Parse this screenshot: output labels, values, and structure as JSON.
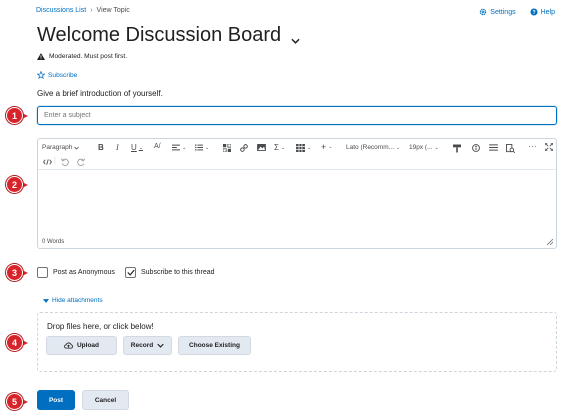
{
  "breadcrumb": {
    "link": "Discussions List",
    "current": "View Topic"
  },
  "header": {
    "settings": "Settings",
    "help": "Help"
  },
  "title": "Welcome Discussion Board",
  "moderated_text": "Moderated.  Must post first.",
  "subscribe_label": "Subscribe",
  "prompt": "Give a brief introduction of yourself.",
  "subject": {
    "placeholder": "Enter a subject",
    "value": ""
  },
  "editor": {
    "format_label": "Paragraph",
    "font_label": "Lato (Recomm...",
    "size_label": "19px (...",
    "word_count": "0 Words"
  },
  "options": {
    "anonymous": "Post as Anonymous",
    "subscribe_thread": "Subscribe to this thread",
    "anonymous_checked": false,
    "subscribe_checked": true
  },
  "attachments": {
    "toggle": "Hide attachments",
    "drop_text": "Drop files here, or click below!",
    "upload": "Upload",
    "record": "Record",
    "choose_existing": "Choose Existing"
  },
  "actions": {
    "post": "Post",
    "cancel": "Cancel"
  },
  "callouts": [
    "1",
    "2",
    "3",
    "4",
    "5"
  ],
  "colors": {
    "accent": "#006fbf",
    "callout": "#d8232a",
    "button_bg": "#e3e9f1"
  }
}
